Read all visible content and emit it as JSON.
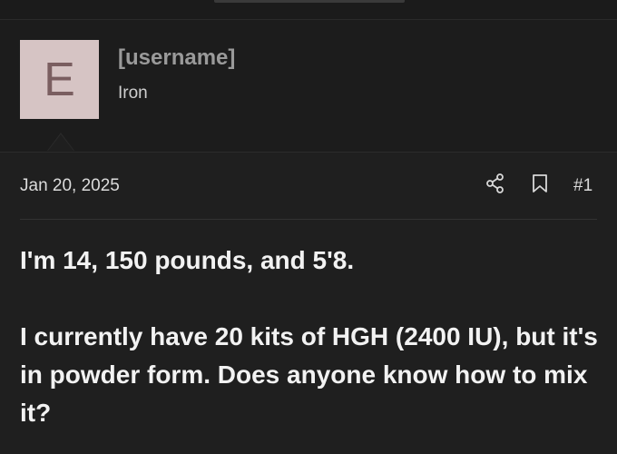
{
  "user": {
    "avatar_letter": "E",
    "avatar_color": "#d6c4c4",
    "username": "[username]",
    "title": "Iron"
  },
  "post": {
    "date": "Jan 20, 2025",
    "number": "#1",
    "icons": [
      "share-icon",
      "bookmark-icon"
    ],
    "paragraphs": [
      "I'm 14, 150 pounds, and 5'8.",
      "I currently have 20 kits of HGH (2400 IU), but it's in powder form. Does anyone know how to mix it?"
    ]
  }
}
